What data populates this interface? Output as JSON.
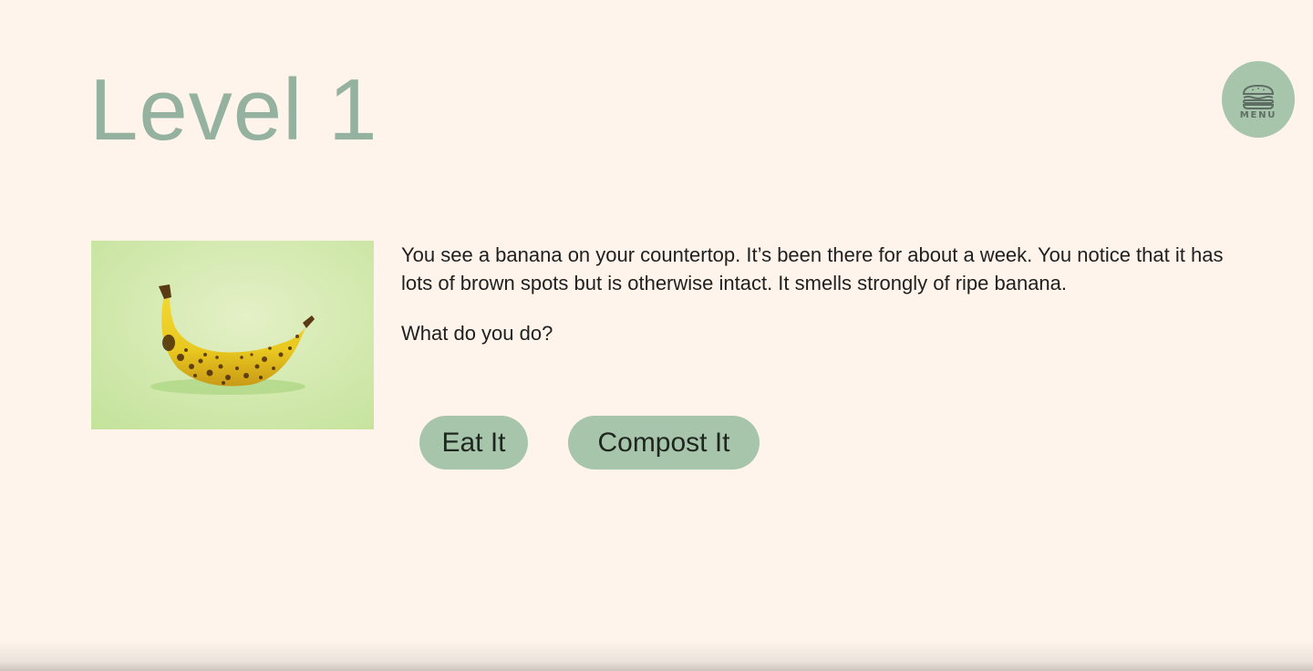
{
  "header": {
    "title": "Level 1"
  },
  "menu": {
    "label": "MENU",
    "icon": "burger-icon",
    "color": "#a7c5ab"
  },
  "scene": {
    "image_icon": "banana-image",
    "description": "You see a banana on your countertop. It’s been there for about a week. You notice that it has lots of brown spots but is otherwise intact. It smells strongly of ripe banana.",
    "question": "What do you do?"
  },
  "choices": [
    {
      "label": "Eat It"
    },
    {
      "label": "Compost It"
    }
  ],
  "colors": {
    "background": "#fef4ec",
    "title": "#94b29f",
    "button": "#a7c5ab",
    "text": "#1f1f1f"
  }
}
